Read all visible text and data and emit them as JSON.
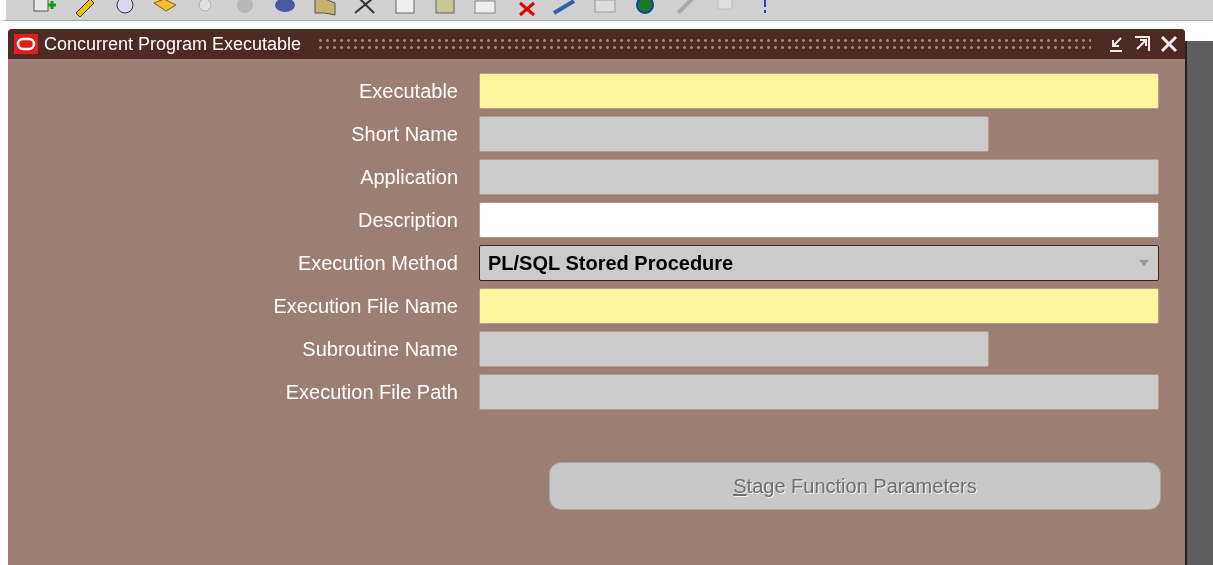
{
  "window": {
    "title": "Concurrent Program Executable"
  },
  "fields": [
    {
      "label": "Executable",
      "kind": "required",
      "narrow": false
    },
    {
      "label": "Short Name",
      "kind": "readonly",
      "narrow": true
    },
    {
      "label": "Application",
      "kind": "readonly",
      "narrow": false
    },
    {
      "label": "Description",
      "kind": "editable",
      "narrow": false
    },
    {
      "label": "Execution Method",
      "kind": "select",
      "narrow": false,
      "value": "PL/SQL Stored Procedure"
    },
    {
      "label": "Execution File Name",
      "kind": "required",
      "narrow": false
    },
    {
      "label": "Subroutine Name",
      "kind": "readonly",
      "narrow": true
    },
    {
      "label": "Execution File Path",
      "kind": "readonly",
      "narrow": false
    }
  ],
  "button": {
    "mnemonic": "S",
    "rest": "tage Function Parameters",
    "disabled": true
  }
}
